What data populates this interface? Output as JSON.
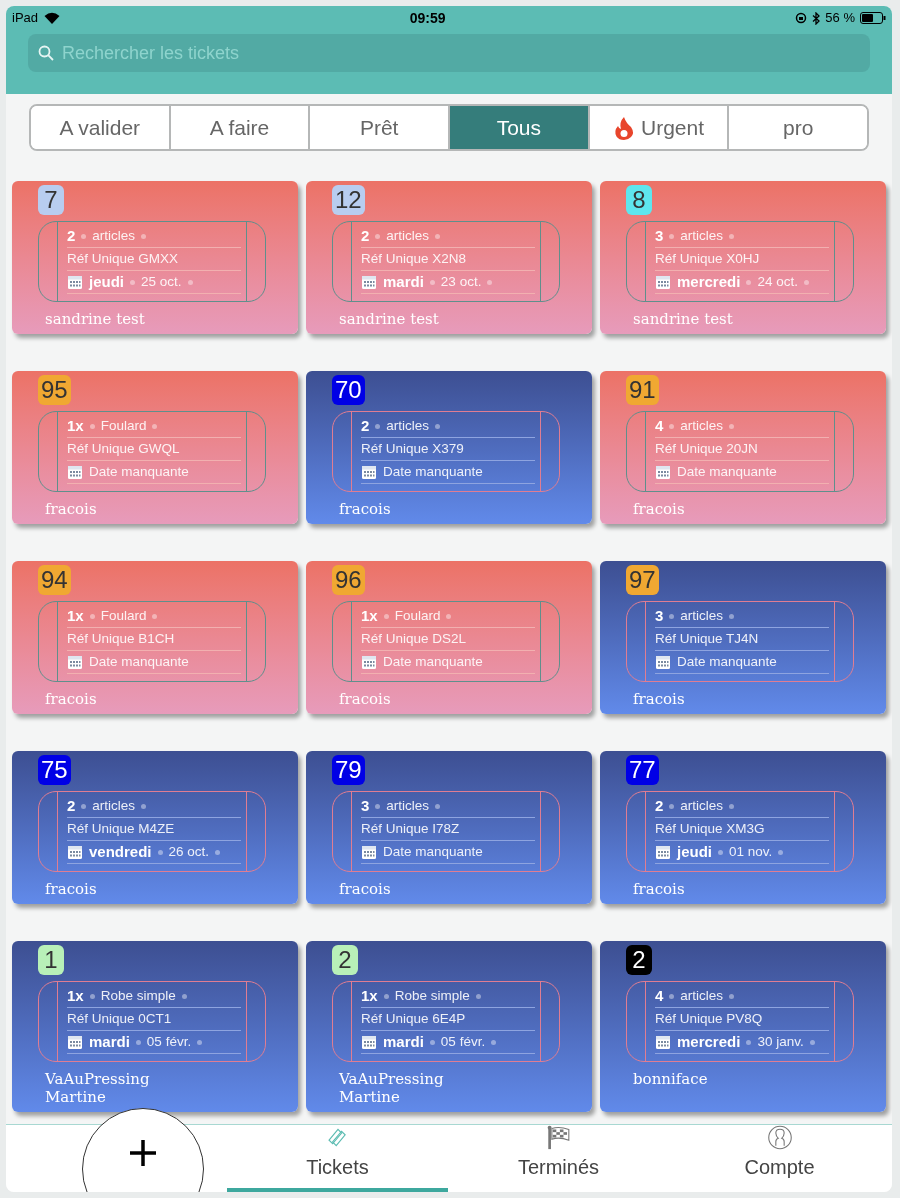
{
  "status_bar": {
    "device": "iPad",
    "time": "09:59",
    "battery": "56 %"
  },
  "search": {
    "placeholder": "Rechercher les tickets"
  },
  "filters": [
    {
      "label": "A valider",
      "selected": false
    },
    {
      "label": "A faire",
      "selected": false
    },
    {
      "label": "Prêt",
      "selected": false
    },
    {
      "label": "Tous",
      "selected": true
    },
    {
      "label": "Urgent",
      "selected": false,
      "kind": "flame"
    },
    {
      "label": "pro",
      "selected": false
    }
  ],
  "tickets": [
    {
      "kind": "warm",
      "number": "7",
      "color": "#b8cdf0",
      "qty": "2",
      "item": "articles",
      "ref": "Réf Unique GMXX",
      "day": "jeudi",
      "date": "25 oct.",
      "client": "sandrine test"
    },
    {
      "kind": "warm",
      "number": "12",
      "color": "#b8cdf0",
      "qty": "2",
      "item": "articles",
      "ref": "Réf Unique X2N8",
      "day": "mardi",
      "date": "23 oct.",
      "client": "sandrine test"
    },
    {
      "kind": "warm",
      "number": "8",
      "color": "#5ee6ee",
      "qty": "3",
      "item": "articles",
      "ref": "Réf Unique X0HJ",
      "day": "mercredi",
      "date": "24 oct.",
      "client": "sandrine test"
    },
    {
      "kind": "warm",
      "number": "95",
      "color": "#f0a832",
      "qty": "1x",
      "item": "Foulard",
      "ref": "Réf Unique GWQL",
      "date_note": "Date manquante",
      "client": "fracois"
    },
    {
      "kind": "cool",
      "number": "70",
      "color": "#0000e6",
      "qty": "2",
      "item": "articles",
      "ref": "Réf Unique X379",
      "date_note": "Date manquante",
      "client": "fracois"
    },
    {
      "kind": "warm",
      "number": "91",
      "color": "#f0a832",
      "qty": "4",
      "item": "articles",
      "ref": "Réf Unique 20JN",
      "date_note": "Date manquante",
      "client": "fracois"
    },
    {
      "kind": "warm",
      "number": "94",
      "color": "#f0a832",
      "qty": "1x",
      "item": "Foulard",
      "ref": "Réf Unique B1CH",
      "date_note": "Date manquante",
      "client": "fracois"
    },
    {
      "kind": "warm",
      "number": "96",
      "color": "#f0a832",
      "qty": "1x",
      "item": "Foulard",
      "ref": "Réf Unique DS2L",
      "date_note": "Date manquante",
      "client": "fracois"
    },
    {
      "kind": "cool",
      "number": "97",
      "color": "#f0a832",
      "qty": "3",
      "item": "articles",
      "ref": "Réf Unique TJ4N",
      "date_note": "Date manquante",
      "client": "fracois"
    },
    {
      "kind": "cool",
      "number": "75",
      "color": "#0000e6",
      "qty": "2",
      "item": "articles",
      "ref": "Réf Unique M4ZE",
      "day": "vendredi",
      "date": "26 oct.",
      "client": "fracois"
    },
    {
      "kind": "cool",
      "number": "79",
      "color": "#0000e6",
      "qty": "3",
      "item": "articles",
      "ref": "Réf Unique I78Z",
      "date_note": "Date manquante",
      "client": "fracois"
    },
    {
      "kind": "cool",
      "number": "77",
      "color": "#0000e6",
      "qty": "2",
      "item": "articles",
      "ref": "Réf Unique XM3G",
      "day": "jeudi",
      "date": "01 nov.",
      "client": "fracois"
    },
    {
      "kind": "cool",
      "number": "1",
      "color": "#b8f0b8",
      "qty": "1x",
      "item": "Robe simple",
      "ref": "Réf Unique 0CT1",
      "day": "mardi",
      "date": "05 févr.",
      "client": "VaAuPressing Martine"
    },
    {
      "kind": "cool",
      "number": "2",
      "color": "#b8f0b8",
      "qty": "1x",
      "item": "Robe simple",
      "ref": "Réf Unique 6E4P",
      "day": "mardi",
      "date": "05 févr.",
      "client": "VaAuPressing Martine"
    },
    {
      "kind": "cool",
      "number": "2",
      "color": "#000000",
      "qty": "4",
      "item": "articles",
      "ref": "Réf Unique PV8Q",
      "day": "mercredi",
      "date": "30 janv.",
      "client": "bonniface"
    }
  ],
  "tab_bar": [
    {
      "label": "Tickets",
      "selected": true,
      "kind": "tickets"
    },
    {
      "label": "Terminés",
      "selected": false,
      "kind": "flag"
    },
    {
      "label": "Compte",
      "selected": false,
      "kind": "user"
    }
  ]
}
